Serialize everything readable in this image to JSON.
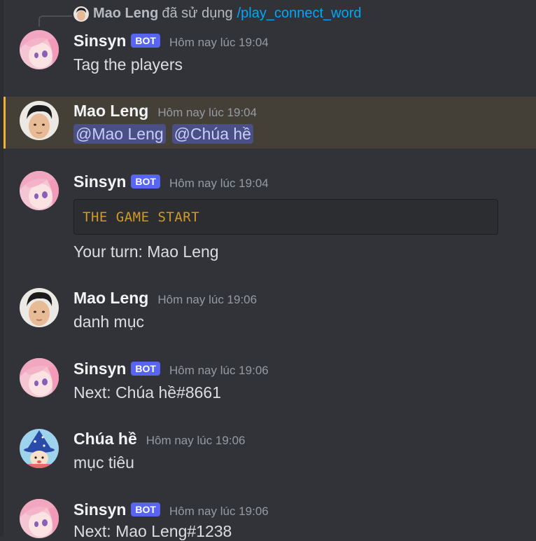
{
  "reply": {
    "user": "Mao Leng",
    "verb": "đã sử dụng",
    "command": "/play_connect_word"
  },
  "messages": [
    {
      "user": "Sinsyn",
      "bot_badge": "BOT",
      "timestamp": "Hôm nay lúc 19:04",
      "text": "Tag the players"
    },
    {
      "user": "Mao Leng",
      "timestamp": "Hôm nay lúc 19:04",
      "mentions": [
        "@Mao Leng",
        "@Chúa hề"
      ]
    },
    {
      "user": "Sinsyn",
      "bot_badge": "BOT",
      "timestamp": "Hôm nay lúc 19:04",
      "code": "THE GAME START",
      "text": "Your turn: Mao Leng"
    },
    {
      "user": "Mao Leng",
      "timestamp": "Hôm nay lúc 19:06",
      "text": "danh mục"
    },
    {
      "user": "Sinsyn",
      "bot_badge": "BOT",
      "timestamp": "Hôm nay lúc 19:06",
      "text": "Next: Chúa hề#8661"
    },
    {
      "user": "Chúa hề",
      "timestamp": "Hôm nay lúc 19:06",
      "text": "mục tiêu"
    },
    {
      "user": "Sinsyn",
      "bot_badge": "BOT",
      "timestamp": "Hôm nay lúc 19:06",
      "text": "Next: Mao Leng#1238"
    }
  ],
  "colors": {
    "background": "#313338",
    "mention_highlight": "#444037",
    "mention_bar": "#f0b232",
    "bot_badge": "#5865f2",
    "command_link": "#00a8fc",
    "code_text": "#d19a23"
  },
  "icons": {
    "sinsyn_avatar": "anime-girl-pink-avatar",
    "maoleng_avatar": "man-portrait-avatar",
    "chuahe_avatar": "wizard-hat-avatar"
  }
}
